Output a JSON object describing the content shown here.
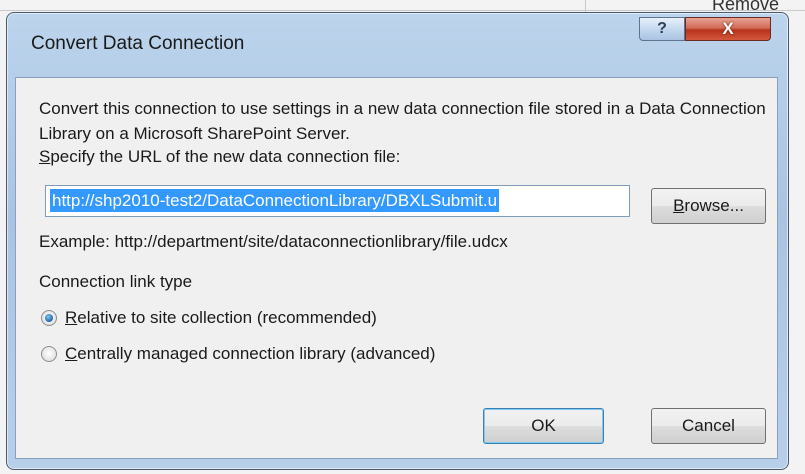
{
  "background": {
    "fragment_text": "Remove"
  },
  "dialog": {
    "title": "Convert Data Connection",
    "help_glyph": "?",
    "close_glyph": "X",
    "description": "Convert this connection to use settings in a new data connection file stored in a Data Connection Library on a Microsoft SharePoint Server.",
    "url_label": "Specify the URL of the new data connection file:",
    "url_value": "http://shp2010-test2/DataConnectionLibrary/DBXLSubmit.u",
    "browse_label": "Browse...",
    "example_text": "Example: http://department/site/dataconnectionlibrary/file.udcx",
    "link_type_label": "Connection link type",
    "options": [
      {
        "label": "Relative to site collection (recommended)",
        "selected": true
      },
      {
        "label": "Centrally managed connection library (advanced)",
        "selected": false
      }
    ],
    "ok_label": "OK",
    "cancel_label": "Cancel"
  },
  "colors": {
    "selection": "#3399ff",
    "title_gradient": "#a9c4e2",
    "close_button": "#c0392b"
  },
  "icons": {
    "help": "question-mark-icon",
    "close": "close-icon"
  }
}
